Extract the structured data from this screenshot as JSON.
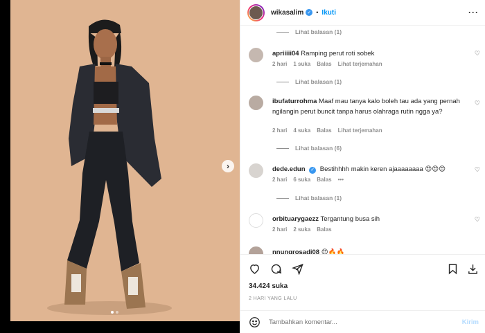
{
  "header": {
    "username": "wikasalim",
    "separator": "•",
    "follow_label": "Ikuti",
    "more_label": "···"
  },
  "carousel": {
    "next_label": "›",
    "page_count": 2,
    "active_page": 1
  },
  "comments": {
    "replies_1": "Lihat balasan (1)",
    "c1": {
      "user": "apriiiii04",
      "text": "Ramping perut roti sobek",
      "time": "2 hari",
      "likes": "1 suka",
      "reply": "Balas",
      "translate": "Lihat terjemahan"
    },
    "replies_2": "Lihat balasan (1)",
    "c2": {
      "user": "ibufaturrohma",
      "text": "Maaf mau tanya kalo boleh tau ada yang pernah ngilangin perut buncit tanpa harus olahraga rutin ngga ya?",
      "time": "2 hari",
      "likes": "4 suka",
      "reply": "Balas",
      "translate": "Lihat terjemahan"
    },
    "replies_3": "Lihat balasan (6)",
    "c3": {
      "user": "dede.edun",
      "text": "Bestihhhh makin keren ajaaaaaaaa 😍😍😍",
      "time": "2 hari",
      "likes": "6 suka",
      "reply": "Balas",
      "more": "•••"
    },
    "replies_4": "Lihat balasan (1)",
    "c4": {
      "user": "orbituarygaezz",
      "text": "Tergantung busa sih",
      "time": "2 hari",
      "likes": "2 suka",
      "reply": "Balas"
    },
    "c5": {
      "user": "nnungrosadi08",
      "text": "😍🔥🔥"
    }
  },
  "footer": {
    "likes": "34.424 suka",
    "time": "2 HARI YANG LALU",
    "comment_placeholder": "Tambahkan komentar...",
    "post_label": "Kirim"
  },
  "colors": {
    "accent": "#0095f6",
    "photo_bg": "#e0b592",
    "muted": "#8e8e8e"
  }
}
